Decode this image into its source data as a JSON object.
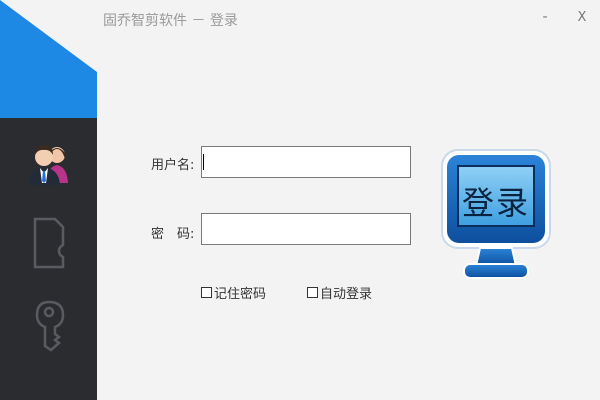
{
  "window": {
    "title": "固乔智剪软件 － 登录",
    "minimize_label": "-",
    "close_label": "X"
  },
  "sidebar": {
    "items": [
      {
        "icon": "users-icon"
      },
      {
        "icon": "sd-card-icon"
      },
      {
        "icon": "key-icon"
      }
    ],
    "accent_color": "#1e88e5",
    "bg_color": "#2b2c30"
  },
  "form": {
    "username_label": "用户名:",
    "password_label": "密　码:",
    "username_value": "",
    "password_value": "",
    "remember_label": "记住密码",
    "autologin_label": "自动登录"
  },
  "login_button": {
    "label": "登录",
    "color": "#1565c0"
  }
}
